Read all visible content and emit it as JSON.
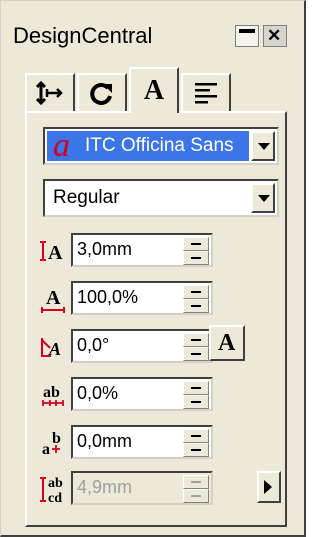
{
  "window": {
    "title": "DesignCentral"
  },
  "titlebar": {
    "close_glyph": "✕"
  },
  "tabs": [
    {
      "name": "tab-paragraph-spacing",
      "icon": "spacing-arrows-icon"
    },
    {
      "name": "tab-rotate",
      "icon": "rotate-arrow-icon"
    },
    {
      "name": "tab-character",
      "icon": "letter-a-icon",
      "label": "A",
      "active": true
    },
    {
      "name": "tab-alignment",
      "icon": "align-left-lines-icon"
    }
  ],
  "font": {
    "icon_glyph": "a",
    "name": "ITC Officina Sans"
  },
  "style": {
    "value": "Regular"
  },
  "fields": [
    {
      "name": "font-size",
      "icon": "font-size-icon",
      "value": "3,0mm"
    },
    {
      "name": "horizontal-scale",
      "icon": "horizontal-scale-icon",
      "value": "100,0%"
    },
    {
      "name": "slant-angle",
      "icon": "slant-angle-icon",
      "value": "0,0°"
    },
    {
      "name": "character-spacing",
      "icon": "character-spacing-icon",
      "value": "0,0%"
    },
    {
      "name": "baseline-offset",
      "icon": "baseline-offset-icon",
      "value": "0,0mm"
    },
    {
      "name": "line-spacing",
      "icon": "line-spacing-icon",
      "value": "4,9mm",
      "disabled": true
    }
  ],
  "buttons": {
    "text_style_label": "A"
  },
  "colors": {
    "selection": "#3b75e8",
    "font_glyph": "#d6001c",
    "face": "#ece9d8"
  }
}
